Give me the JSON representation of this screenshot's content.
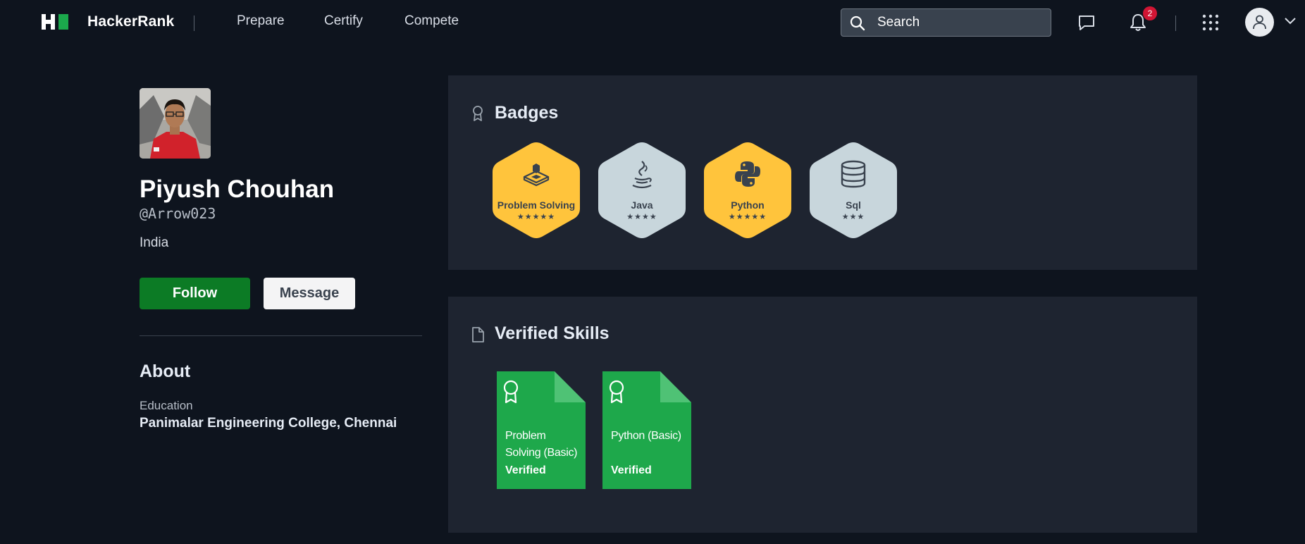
{
  "nav": {
    "brand": "HackerRank",
    "links": [
      "Prepare",
      "Certify",
      "Compete"
    ],
    "search_placeholder": "Search",
    "notification_count": "2",
    "icons": [
      "chat-icon",
      "bell-icon",
      "apps-grid-icon",
      "user-icon",
      "chevron-down-icon"
    ]
  },
  "profile": {
    "name": "Piyush Chouhan",
    "handle": "@Arrow023",
    "country": "India",
    "follow_label": "Follow",
    "message_label": "Message",
    "about_heading": "About",
    "education_label": "Education",
    "education_value": "Panimalar Engineering College, Chennai"
  },
  "badges": {
    "title": "Badges",
    "items": [
      {
        "name": "Problem Solving",
        "stars": "★★★★★",
        "star_count": 5,
        "tier": "gold",
        "icon": "problem-solving-icon"
      },
      {
        "name": "Java",
        "stars": "★★★★",
        "star_count": 4,
        "tier": "silver",
        "icon": "java-icon"
      },
      {
        "name": "Python",
        "stars": "★★★★★",
        "star_count": 5,
        "tier": "gold",
        "icon": "python-icon"
      },
      {
        "name": "Sql",
        "stars": "★★★",
        "star_count": 3,
        "tier": "silver",
        "icon": "database-icon"
      }
    ]
  },
  "skills": {
    "title": "Verified Skills",
    "items": [
      {
        "name": "Problem Solving (Basic)",
        "status": "Verified"
      },
      {
        "name": "Python (Basic)",
        "status": "Verified"
      }
    ]
  },
  "colors": {
    "background": "#0e141e",
    "card": "#1e2430",
    "follow_green": "#0c7b25",
    "skill_green": "#1ea84b",
    "gold": "#ffc43c",
    "silver": "#c8d6dc",
    "notification_red": "#d11534"
  }
}
